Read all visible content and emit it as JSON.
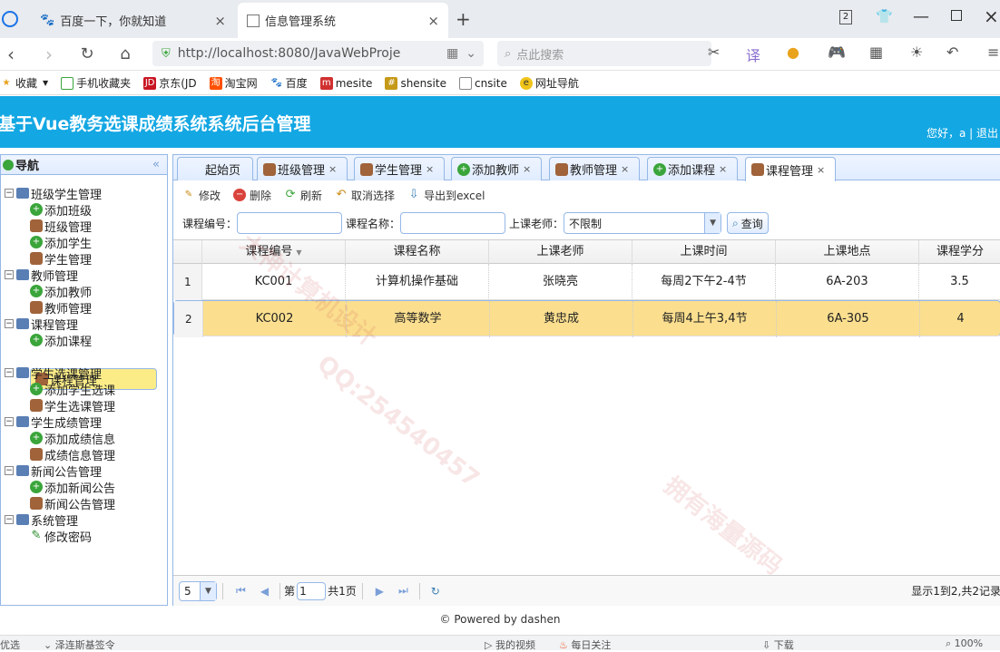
{
  "browser": {
    "tabs": [
      {
        "title": "百度一下，你就知道"
      },
      {
        "title": "信息管理系统"
      }
    ],
    "url": "http://localhost:8080/JavaWebProje",
    "search_placeholder": "点此搜索",
    "window_num": "2",
    "bookmarks": [
      "收藏",
      "手机收藏夹",
      "京东(JD",
      "淘宝网",
      "百度",
      "mesite",
      "shensite",
      "cnsite",
      "网址导航"
    ]
  },
  "header": {
    "title": "基于Vue教务选课成绩系统系统后台管理",
    "user": "您好，a | 退出"
  },
  "sidebar": {
    "title": "导航",
    "groups": [
      {
        "label": "班级学生管理",
        "items": [
          "添加班级",
          "班级管理",
          "添加学生",
          "学生管理"
        ]
      },
      {
        "label": "教师管理",
        "items": [
          "添加教师",
          "教师管理"
        ]
      },
      {
        "label": "课程管理",
        "items": [
          "添加课程",
          "课程管理"
        ]
      },
      {
        "label": "学生选课管理",
        "items": [
          "添加学生选课",
          "学生选课管理"
        ]
      },
      {
        "label": "学生成绩管理",
        "items": [
          "添加成绩信息",
          "成绩信息管理"
        ]
      },
      {
        "label": "新闻公告管理",
        "items": [
          "添加新闻公告",
          "新闻公告管理"
        ]
      },
      {
        "label": "系统管理",
        "items": [
          "修改密码"
        ]
      }
    ]
  },
  "page_tabs": [
    "起始页",
    "班级管理",
    "学生管理",
    "添加教师",
    "教师管理",
    "添加课程",
    "课程管理"
  ],
  "toolbar": {
    "edit": "修改",
    "delete": "删除",
    "refresh": "刷新",
    "cancel": "取消选择",
    "export": "导出到excel"
  },
  "filters": {
    "course_no_label": "课程编号：",
    "course_name_label": "课程名称：",
    "teacher_label": "上课老师：",
    "teacher_value": "不限制",
    "query": "查询"
  },
  "grid": {
    "columns": [
      "课程编号",
      "课程名称",
      "上课老师",
      "上课时间",
      "上课地点",
      "课程学分"
    ],
    "rows": [
      {
        "n": "1",
        "cells": [
          "KC001",
          "计算机操作基础",
          "张晓亮",
          "每周2下午2-4节",
          "6A-203",
          "3.5"
        ]
      },
      {
        "n": "2",
        "cells": [
          "KC002",
          "高等数学",
          "黄忠成",
          "每周4上午3,4节",
          "6A-305",
          "4"
        ]
      }
    ]
  },
  "pager": {
    "size": "5",
    "page_prefix": "第",
    "page": "1",
    "page_suffix": "共1页",
    "summary": "显示1到2,共2记录"
  },
  "footer": "© Powered by dashen",
  "statusbar": {
    "left": "优选",
    "left2": "泽连斯基签令",
    "video": "我的视频",
    "follow": "每日关注",
    "download": "下载",
    "zoom": "100%"
  },
  "watermarks": [
    "大神计算机设计",
    "QQ:254540457",
    "拥有海量源码"
  ]
}
